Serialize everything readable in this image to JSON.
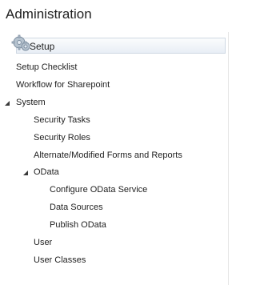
{
  "header": {
    "title": "Administration"
  },
  "setup": {
    "label": "Setup",
    "icon": "gears-icon"
  },
  "tree": [
    {
      "label": "Setup Checklist",
      "level": 0,
      "expanded": null
    },
    {
      "label": "Workflow for Sharepoint",
      "level": 0,
      "expanded": null
    },
    {
      "label": "System",
      "level": 0,
      "expanded": true
    },
    {
      "label": "Security Tasks",
      "level": 1,
      "expanded": null
    },
    {
      "label": "Security Roles",
      "level": 1,
      "expanded": null
    },
    {
      "label": "Alternate/Modified Forms and Reports",
      "level": 1,
      "expanded": null
    },
    {
      "label": "OData",
      "level": 1,
      "expanded": true
    },
    {
      "label": "Configure OData Service",
      "level": 2,
      "expanded": null
    },
    {
      "label": "Data Sources",
      "level": 2,
      "expanded": null
    },
    {
      "label": "Publish OData",
      "level": 2,
      "expanded": null
    },
    {
      "label": "User",
      "level": 1,
      "expanded": null
    },
    {
      "label": "User Classes",
      "level": 1,
      "expanded": null
    }
  ]
}
